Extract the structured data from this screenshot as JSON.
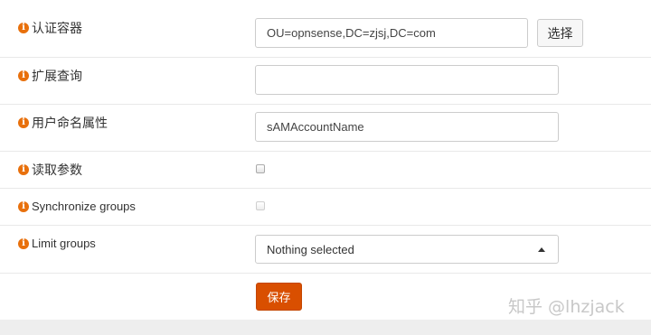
{
  "form": {
    "auth_container": {
      "label": "认证容器",
      "value": "OU=opnsense,DC=zjsj,DC=com",
      "select_button": "选择"
    },
    "extended_query": {
      "label": "扩展查询",
      "value": ""
    },
    "user_naming_attribute": {
      "label": "用户命名属性",
      "value": "sAMAccountName"
    },
    "read_properties": {
      "label": "读取参数",
      "checked": false
    },
    "synchronize_groups": {
      "label": "Synchronize groups",
      "checked": false
    },
    "limit_groups": {
      "label": "Limit groups",
      "selected": "Nothing selected"
    },
    "save_button": "保存"
  },
  "icons": {
    "info": "info-icon",
    "dropdown": "caret-up-icon"
  },
  "colors": {
    "accent": "#d94f00",
    "info_icon": "#e8700c"
  },
  "watermark": "知乎 @lhzjack"
}
